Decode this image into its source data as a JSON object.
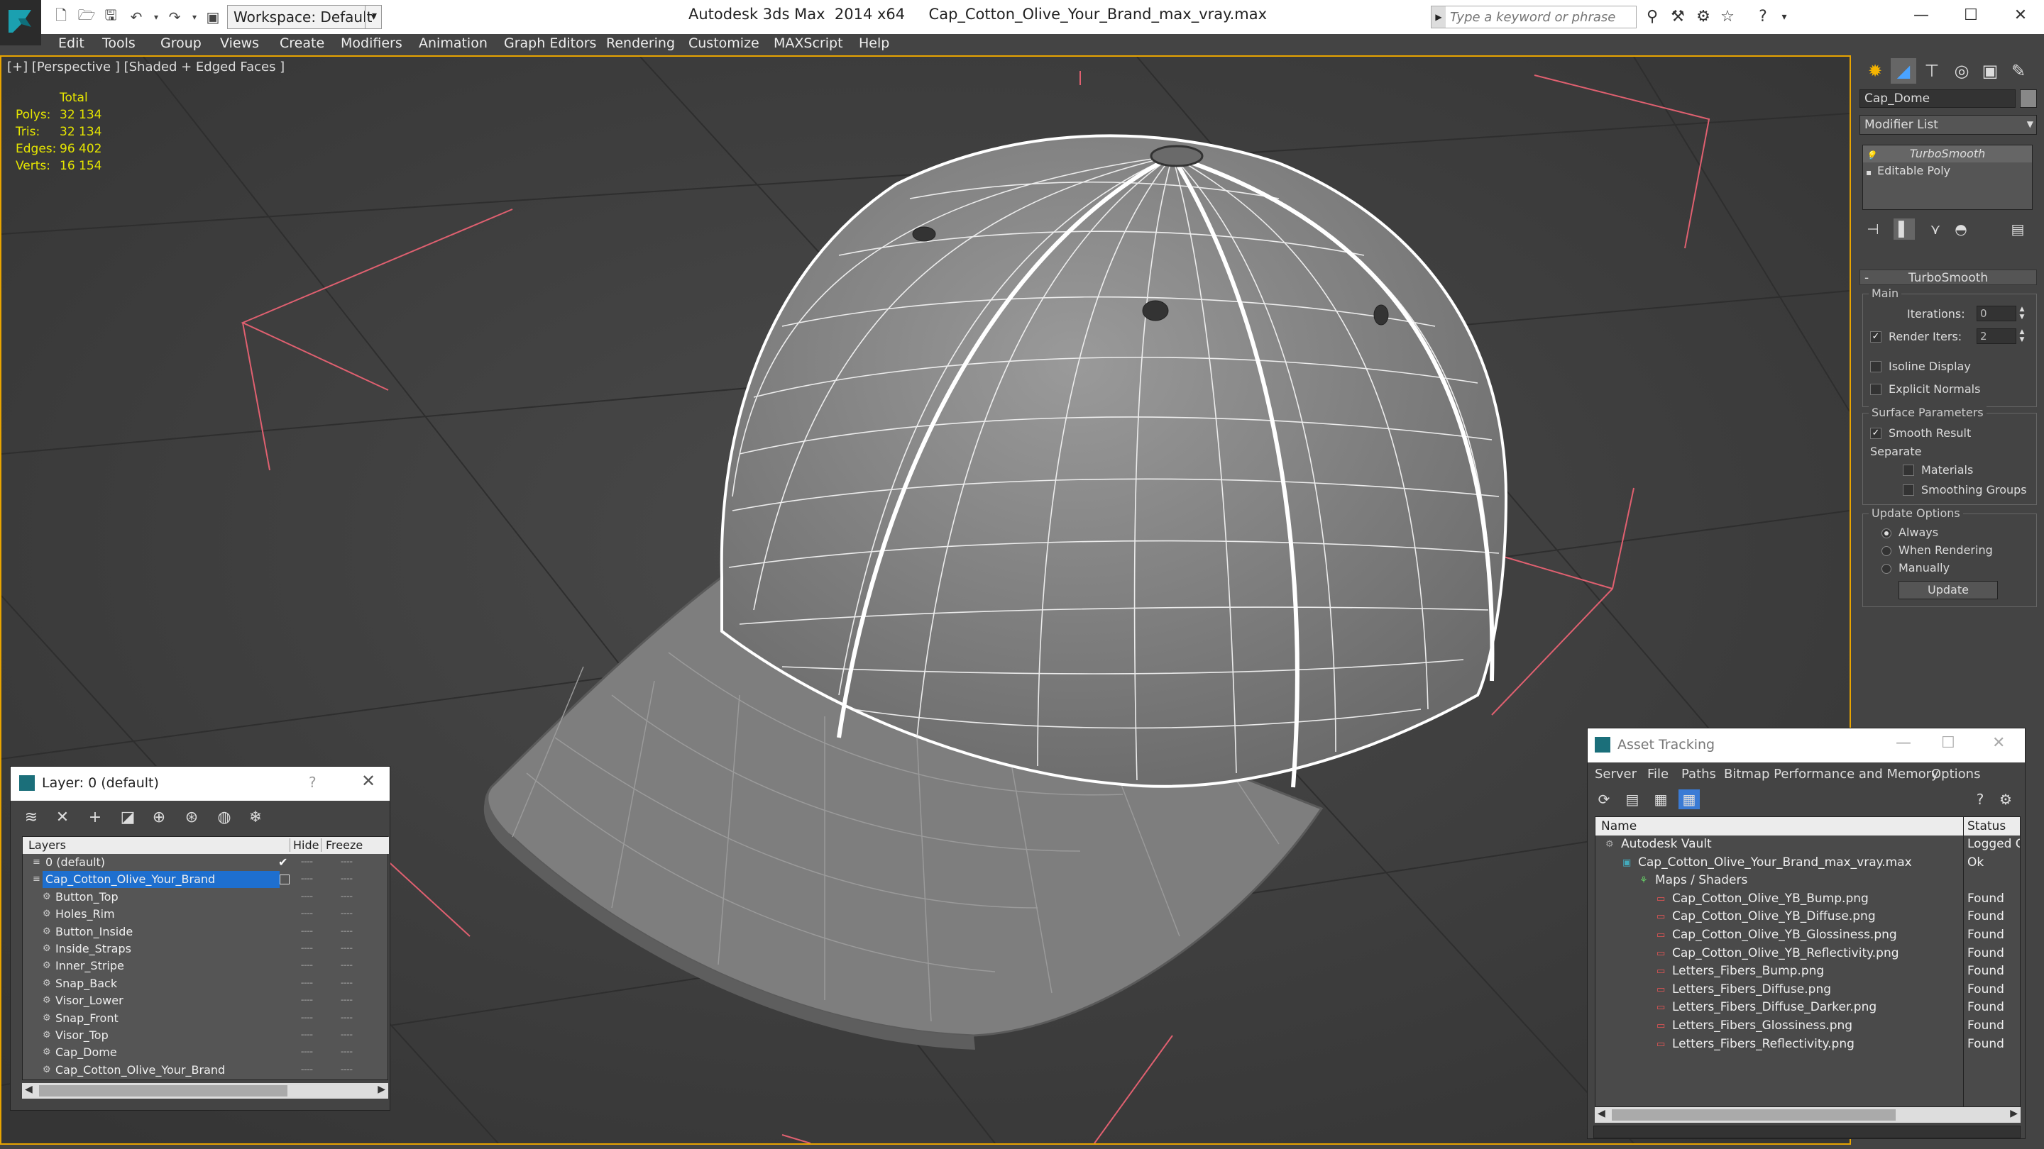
{
  "titlebar": {
    "workspace": "Workspace: Default",
    "app_name": "Autodesk 3ds Max  2014 x64",
    "file_name": "Cap_Cotton_Olive_Your_Brand_max_vray.max",
    "search_placeholder": "Type a keyword or phrase"
  },
  "menu": [
    "Edit",
    "Tools",
    "Group",
    "Views",
    "Create",
    "Modifiers",
    "Animation",
    "Graph Editors",
    "Rendering",
    "Customize",
    "MAXScript",
    "Help"
  ],
  "viewport": {
    "label": "[+] [Perspective ] [Shaded + Edged Faces ]",
    "stats": {
      "header": "Total",
      "rows": [
        {
          "label": "Polys:",
          "value": "32 134"
        },
        {
          "label": "Tris:",
          "value": "32 134"
        },
        {
          "label": "Edges:",
          "value": "96 402"
        },
        {
          "label": "Verts:",
          "value": "16 154"
        }
      ]
    }
  },
  "command_panel": {
    "object_name": "Cap_Dome",
    "modifier_list": "Modifier List",
    "stack": [
      "TurboSmooth",
      "Editable Poly"
    ],
    "rollout_title": "TurboSmooth",
    "main_group": "Main",
    "iterations_label": "Iterations:",
    "iterations_value": "0",
    "render_iters_label": "Render Iters:",
    "render_iters_value": "2",
    "isoline_label": "Isoline Display",
    "explicit_normals_label": "Explicit Normals",
    "surface_group": "Surface Parameters",
    "smooth_result_label": "Smooth Result",
    "separate_label": "Separate",
    "materials_label": "Materials",
    "smoothing_groups_label": "Smoothing Groups",
    "update_group": "Update Options",
    "always_label": "Always",
    "when_rendering_label": "When Rendering",
    "manually_label": "Manually",
    "update_button": "Update"
  },
  "layer_dialog": {
    "title": "Layer: 0 (default)",
    "help": "?",
    "col_layers": "Layers",
    "col_hide": "Hide",
    "col_freeze": "Freeze",
    "rows": [
      {
        "name": "0 (default)",
        "level": 0
      },
      {
        "name": "Cap_Cotton_Olive_Your_Brand",
        "level": 0
      },
      {
        "name": "Button_Top",
        "level": 1
      },
      {
        "name": "Holes_Rim",
        "level": 1
      },
      {
        "name": "Button_Inside",
        "level": 1
      },
      {
        "name": "Inside_Straps",
        "level": 1
      },
      {
        "name": "Inner_Stripe",
        "level": 1
      },
      {
        "name": "Snap_Back",
        "level": 1
      },
      {
        "name": "Visor_Lower",
        "level": 1
      },
      {
        "name": "Snap_Front",
        "level": 1
      },
      {
        "name": "Visor_Top",
        "level": 1
      },
      {
        "name": "Cap_Dome",
        "level": 1
      },
      {
        "name": "Cap_Cotton_Olive_Your_Brand",
        "level": 1
      }
    ]
  },
  "asset_dialog": {
    "title": "Asset Tracking",
    "menu": [
      "Server",
      "File",
      "Paths",
      "Bitmap Performance and Memory",
      "Options"
    ],
    "col_name": "Name",
    "col_status": "Status",
    "rows": [
      {
        "name": "Autodesk Vault",
        "status": "Logged Ou",
        "level": 0
      },
      {
        "name": "Cap_Cotton_Olive_Your_Brand_max_vray.max",
        "status": "Ok",
        "level": 1
      },
      {
        "name": "Maps / Shaders",
        "status": "",
        "level": 2
      },
      {
        "name": "Cap_Cotton_Olive_YB_Bump.png",
        "status": "Found",
        "level": 3
      },
      {
        "name": "Cap_Cotton_Olive_YB_Diffuse.png",
        "status": "Found",
        "level": 3
      },
      {
        "name": "Cap_Cotton_Olive_YB_Glossiness.png",
        "status": "Found",
        "level": 3
      },
      {
        "name": "Cap_Cotton_Olive_YB_Reflectivity.png",
        "status": "Found",
        "level": 3
      },
      {
        "name": "Letters_Fibers_Bump.png",
        "status": "Found",
        "level": 3
      },
      {
        "name": "Letters_Fibers_Diffuse.png",
        "status": "Found",
        "level": 3
      },
      {
        "name": "Letters_Fibers_Diffuse_Darker.png",
        "status": "Found",
        "level": 3
      },
      {
        "name": "Letters_Fibers_Glossiness.png",
        "status": "Found",
        "level": 3
      },
      {
        "name": "Letters_Fibers_Reflectivity.png",
        "status": "Found",
        "level": 3
      }
    ]
  },
  "colors": {
    "viewport_border": "#e8a400",
    "selection": "#1e6fcf",
    "stats": "#e6e600",
    "wire": "#ffffff",
    "helper_lines": "#e06070"
  }
}
